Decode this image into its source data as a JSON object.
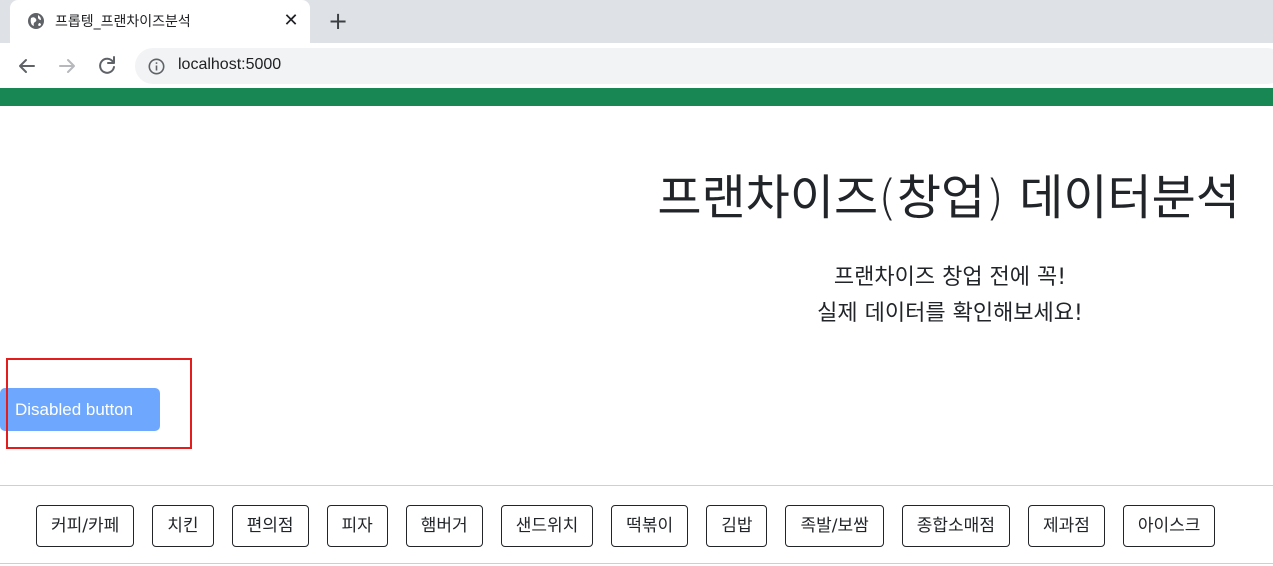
{
  "browser": {
    "tab_title": "프롭텡_프랜차이즈분석",
    "tab_close": "✕",
    "new_tab": "+",
    "url": "localhost:5000"
  },
  "page": {
    "title": "프랜차이즈(창업) 데이터분석",
    "subtitle_line1": "프랜차이즈 창업 전에 꼭!",
    "subtitle_line2": "실제 데이터를 확인해보세요!",
    "disabled_button": "Disabled button"
  },
  "categories": [
    "커피/카페",
    "치킨",
    "편의점",
    "피자",
    "햄버거",
    "샌드위치",
    "떡볶이",
    "김밥",
    "족발/보쌈",
    "종합소매점",
    "제과점",
    "아이스크"
  ],
  "colors": {
    "accent_bar": "#198754",
    "disabled_button": "#6ea8fe",
    "highlight": "#e31c1c"
  }
}
